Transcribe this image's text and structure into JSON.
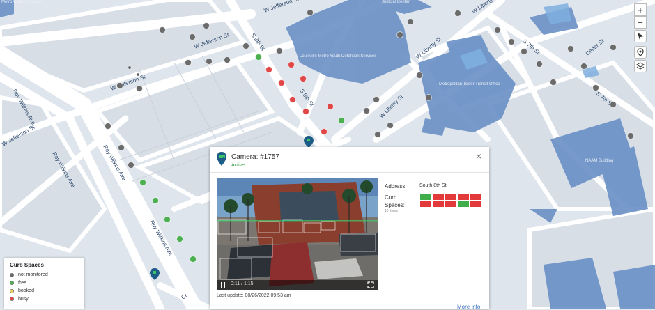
{
  "map": {
    "street_labels": [
      "W Jefferson St",
      "W Jefferson St",
      "W Jefferson St",
      "W Jefferson St",
      "S 8th St",
      "S 8th St",
      "S 7th St",
      "S 7th St",
      "W Liberty St",
      "W Liberty St",
      "W Liberty St",
      "Roy Wilkins Ave",
      "Roy Wilkins Ave",
      "Roy Wilkins Ave",
      "Roy Wilkins Ave",
      "Cedar St",
      "Ct",
      "Ct"
    ],
    "building_labels": [
      "Louisville Metro Youth Detention Services",
      "Metropolitan Tower Transit Office",
      "NAAM Building",
      "Judicial Center",
      "Metro Gateway Tower"
    ],
    "colors": {
      "not_monitored": "#6b6b6b",
      "free": "#4caf50",
      "booked": "#f0d264",
      "busy": "#e04848",
      "building": "#6a90c6",
      "road": "#ffffff",
      "block": "#d9dfe6"
    }
  },
  "controls": {
    "zoom_in": "+",
    "zoom_out": "−",
    "icons": [
      "compass-icon",
      "locate-icon",
      "layers-icon"
    ]
  },
  "legend": {
    "title": "Curb Spaces",
    "items": [
      {
        "label": "not monitored",
        "color": "#6b6b6b"
      },
      {
        "label": "free",
        "color": "#4caf50"
      },
      {
        "label": "booked",
        "color": "#f0d264"
      },
      {
        "label": "busy",
        "color": "#e04848"
      }
    ]
  },
  "popup": {
    "camera": "Camera: #1757",
    "status": "Active",
    "close": "×",
    "address_label": "Address:",
    "address_value": "South 8th St",
    "curb_label": "Curb Spaces:",
    "curb_count": "10 items",
    "slots": [
      "free",
      "busy",
      "busy",
      "busy",
      "busy",
      "busy",
      "busy",
      "busy",
      "free",
      "busy"
    ],
    "video_time": "0:11 / 1:15",
    "last_update": "Last update: 08/26/2022 09:53 am",
    "more_info": "More info"
  }
}
